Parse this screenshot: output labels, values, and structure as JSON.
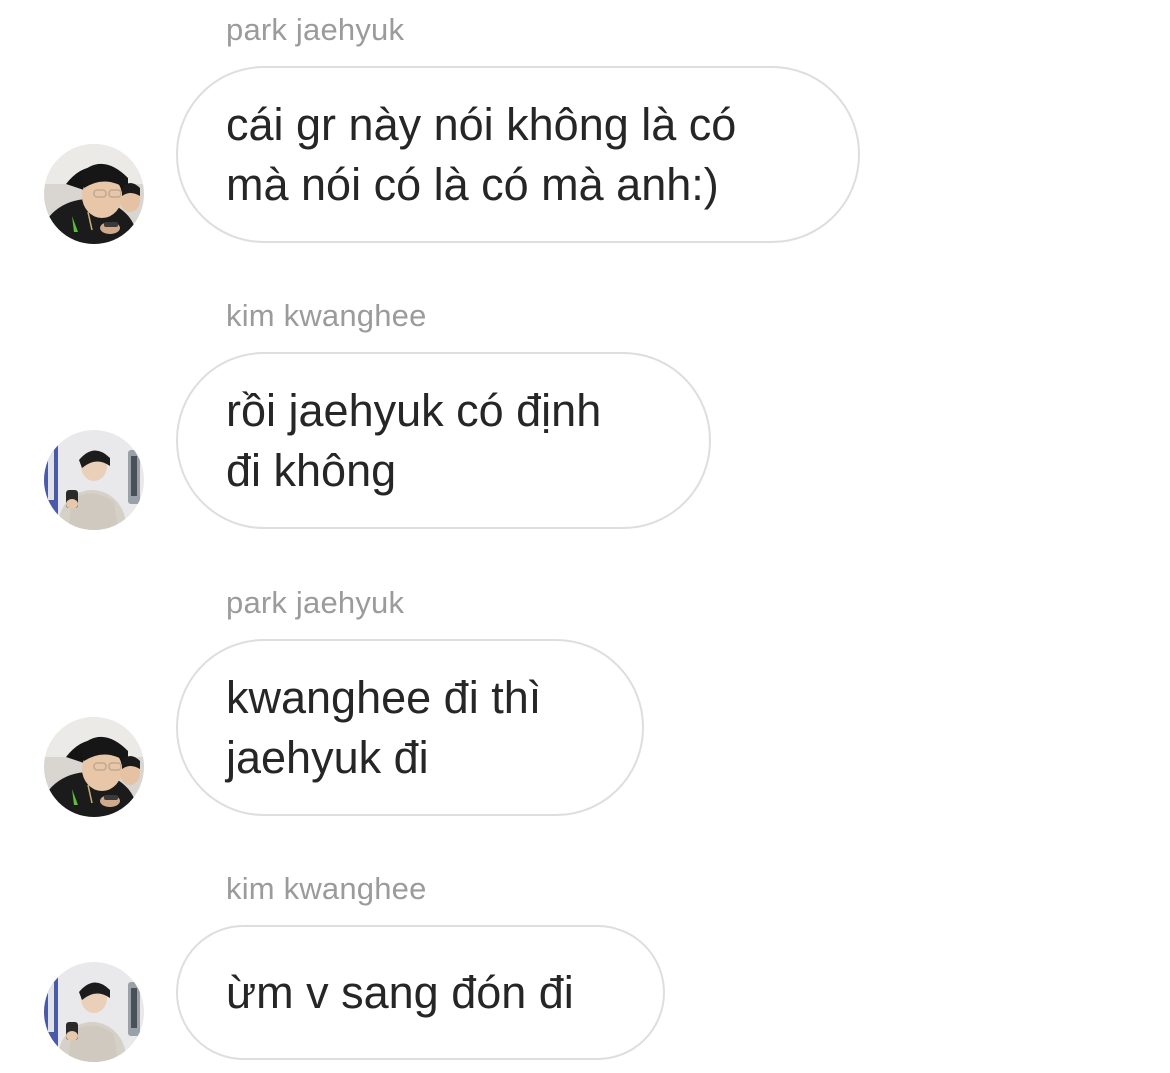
{
  "conversation": {
    "messages": [
      {
        "sender": "park jaehyuk",
        "text": "cái gr này nói không là có\nmà nói có là có mà anh:)",
        "avatar": "avatar-park-jaehyuk"
      },
      {
        "sender": "kim kwanghee",
        "text": "rồi jaehyuk có định\nđi không",
        "avatar": "avatar-kim-kwanghee"
      },
      {
        "sender": "park jaehyuk",
        "text": "kwanghee đi thì\njaehyuk đi",
        "avatar": "avatar-park-jaehyuk"
      },
      {
        "sender": "kim kwanghee",
        "text": "ừm v sang đón đi",
        "avatar": "avatar-kim-kwanghee"
      }
    ]
  },
  "colors": {
    "background": "#ffffff",
    "sender_text": "#9b9b9b",
    "bubble_text": "#262626",
    "bubble_border": "#dedede"
  }
}
